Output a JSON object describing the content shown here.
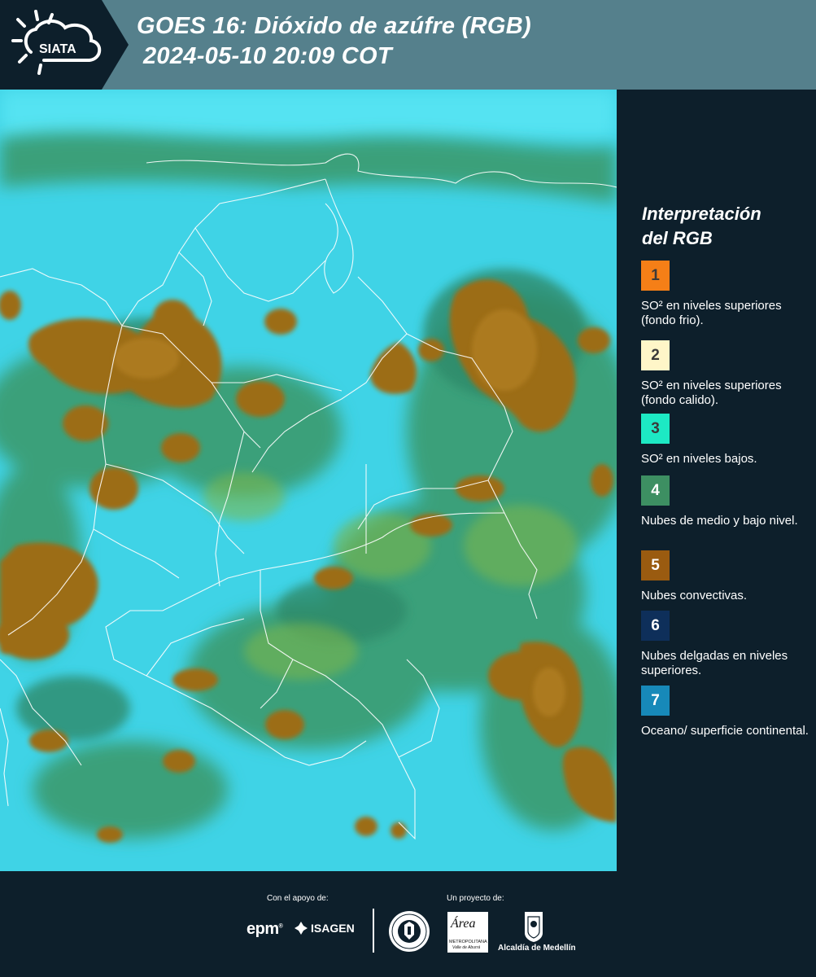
{
  "header": {
    "logo_text": "SIATA",
    "title_line1": "GOES 16: Dióxido de azúfre (RGB)",
    "title_line2": "2024-05-10 20:09 COT"
  },
  "legend": {
    "title_line1": "Interpretación",
    "title_line2": "del RGB",
    "items": [
      {
        "number": "1",
        "color": "#f57f17",
        "label": "SO² en niveles superiores (fondo frio)."
      },
      {
        "number": "2",
        "color": "#fff6c8",
        "label": "SO² en niveles superiores (fondo calido)."
      },
      {
        "number": "3",
        "color": "#1de9c4",
        "label": "SO² en niveles bajos."
      },
      {
        "number": "4",
        "color": "#3d8f62",
        "label": "Nubes de medio y bajo nivel."
      },
      {
        "number": "5",
        "color": "#9a5b10",
        "label": "Nubes convectivas."
      },
      {
        "number": "6",
        "color": "#0e2f5a",
        "label": "Nubes delgadas en niveles superiores."
      },
      {
        "number": "7",
        "color": "#1789b9",
        "label": "Oceano/ superficie continental."
      }
    ]
  },
  "footer": {
    "support_label": "Con el apoyo de:",
    "project_label": "Un proyecto de:",
    "sponsor_epm": "epm",
    "sponsor_isagen": "ISAGEN",
    "area_logo_text": "Área",
    "area_logo_sub": "METROPOLITANA",
    "area_logo_sub2": "Valle de Aburrá",
    "alcaldia_label": "Alcaldía de Medellín"
  },
  "colors": {
    "background": "#0d1f2b",
    "header_bar": "#55808c",
    "ocean": "#3fd3e6",
    "convective": "#9a6a18",
    "low_cloud": "#3b9a73",
    "borders": "#ffffff"
  }
}
